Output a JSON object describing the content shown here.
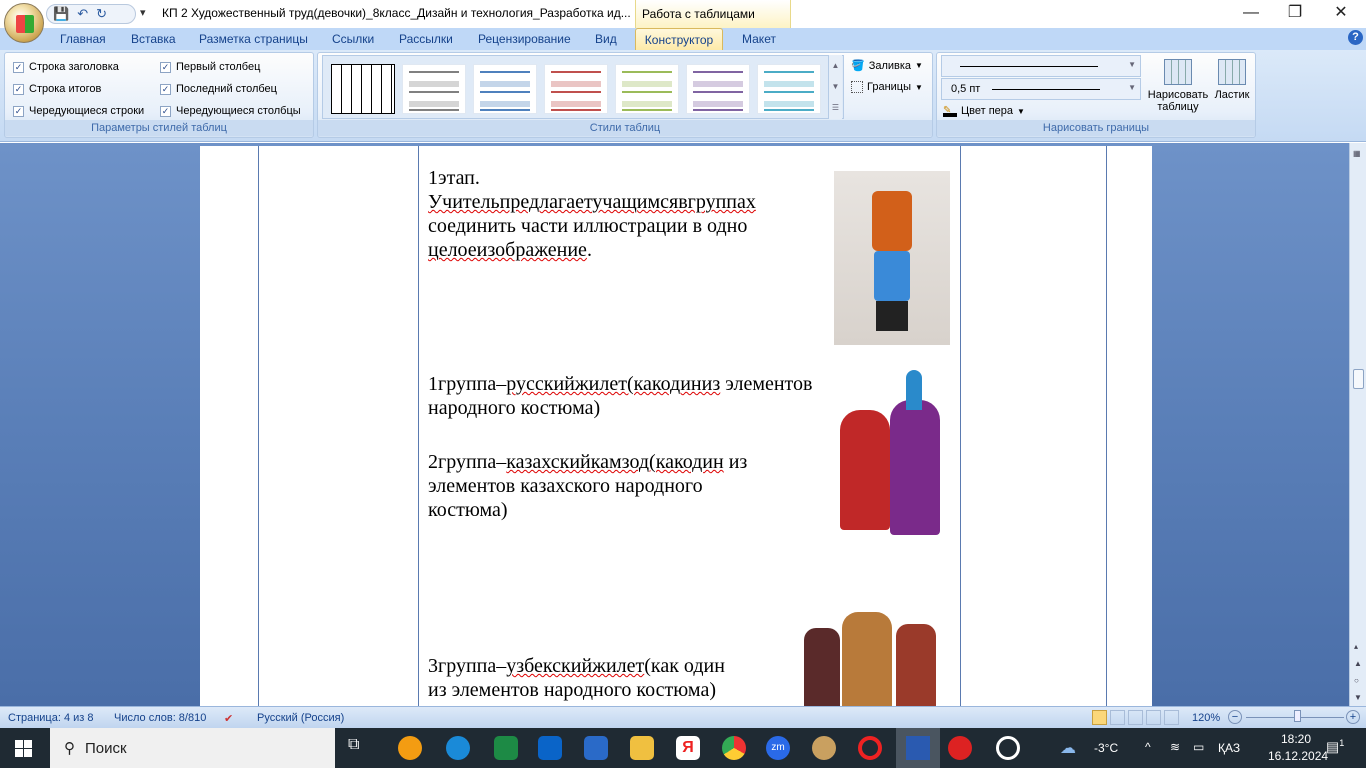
{
  "window": {
    "title": "КП 2 Художественный труд(девочки)_8класс_Дизайн и технология_Разработка ид...",
    "context_tab": "Работа с таблицами",
    "minimize": "—",
    "restore": "❐",
    "close": "✕"
  },
  "qat": {
    "save": "💾",
    "undo": "↶",
    "redo": "↻",
    "customize": "▾"
  },
  "tabs": [
    "Главная",
    "Вставка",
    "Разметка страницы",
    "Ссылки",
    "Рассылки",
    "Рецензирование",
    "Вид",
    "Конструктор",
    "Макет"
  ],
  "ribbon": {
    "style_options": {
      "label": "Параметры стилей таблиц",
      "items": [
        {
          "label": "Строка заголовка",
          "checked": true
        },
        {
          "label": "Строка итогов",
          "checked": true
        },
        {
          "label": "Чередующиеся строки",
          "checked": true
        },
        {
          "label": "Первый столбец",
          "checked": true
        },
        {
          "label": "Последний столбец",
          "checked": true
        },
        {
          "label": "Чередующиеся столбцы",
          "checked": true
        }
      ]
    },
    "table_styles": {
      "label": "Стили таблиц",
      "colors": [
        "#000000",
        "#808080",
        "#4f81bd",
        "#c0504d",
        "#9bbb59",
        "#8064a2",
        "#4bacc6"
      ],
      "fill": "Заливка",
      "borders": "Границы"
    },
    "draw_borders": {
      "label": "Нарисовать границы",
      "weight": "0,5 пт",
      "pen_color": "Цвет пера",
      "draw_table": "Нарисовать таблицу",
      "eraser": "Ластик"
    }
  },
  "document": {
    "stage": "1этап.",
    "stage_text_1": "Учительпредлагаетучащимсявгруппах",
    "stage_text_2": "соединить части иллюстрации в одно",
    "stage_text_3": "целоеизображение",
    "g1_a": "1группа–",
    "g1_b": "русскийжилет(какодиниз",
    "g1_c": " элементов",
    "g1_d": "народного костюма)",
    "g2_a": "2группа–",
    "g2_b": "казахскийкамзод(какодин",
    "g2_c": " из",
    "g2_d": "элементов казахского народного",
    "g2_e": "костюма)",
    "g3_a": "3группа–",
    "g3_b": "узбекскийжилет",
    "g3_c": "(как один",
    "g3_d": "из элементов народного костюма)"
  },
  "status": {
    "page": "Страница: 4 из 8",
    "words": "Число слов: 8/810",
    "language": "Русский (Россия)",
    "zoom": "120%",
    "zoom_value": 120
  },
  "taskbar": {
    "search": "Поиск",
    "weather": "-3°C",
    "lang": "ҚАЗ",
    "time": "18:20",
    "date": "16.12.2024",
    "notifications": "1"
  }
}
